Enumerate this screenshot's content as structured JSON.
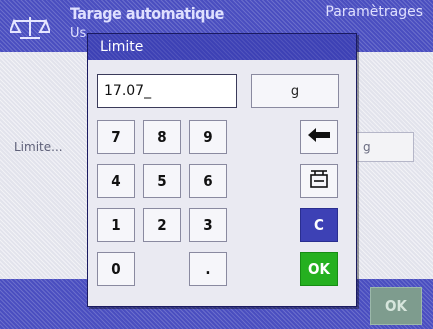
{
  "background": {
    "title": "Tarage automatique",
    "subtitle": "Us",
    "params_label": "Paramètrages",
    "limit_label": "Limite...",
    "unit_field": "g",
    "ok_label": "OK"
  },
  "dialog": {
    "title": "Limite",
    "entry_value": "17.07_",
    "unit_label": "g",
    "keys": {
      "k7": "7",
      "k8": "8",
      "k9": "9",
      "k4": "4",
      "k5": "5",
      "k6": "6",
      "k1": "1",
      "k2": "2",
      "k3": "3",
      "k0": "0",
      "dot": "."
    },
    "clear_label": "C",
    "ok_label": "OK"
  },
  "colors": {
    "header_blue": "#4a4ec0",
    "dialog_title_blue": "#3d41b5",
    "ok_green": "#25b020",
    "clear_blue": "#3d41b5"
  },
  "icons": [
    "scale-icon",
    "backspace-arrow-icon",
    "scale-tare-icon"
  ]
}
